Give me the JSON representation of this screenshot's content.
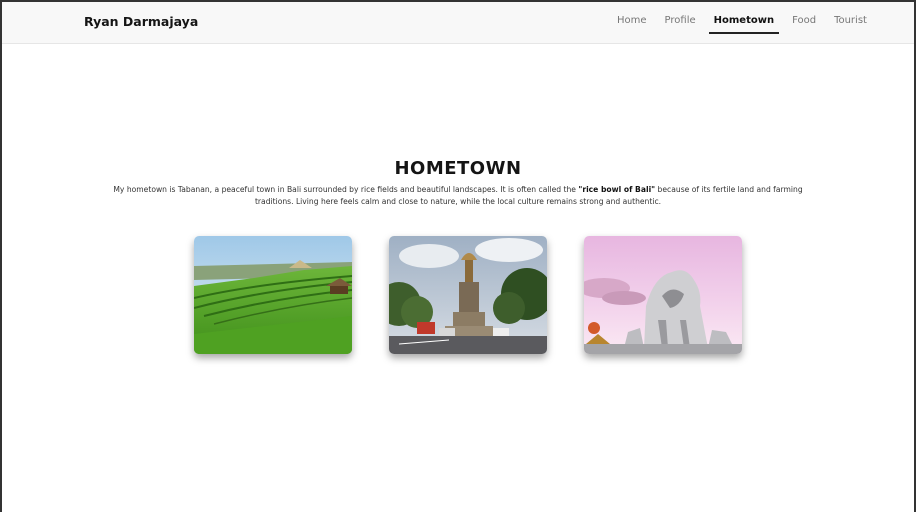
{
  "navbar": {
    "brand": "Ryan Darmajaya",
    "items": [
      {
        "label": "Home",
        "active": false
      },
      {
        "label": "Profile",
        "active": false
      },
      {
        "label": "Hometown",
        "active": true
      },
      {
        "label": "Food",
        "active": false
      },
      {
        "label": "Tourist",
        "active": false
      }
    ]
  },
  "main": {
    "title": "HOMETOWN",
    "description_part1": "My hometown is Tabanan, a peaceful town in Bali surrounded by rice fields and beautiful landscapes. It is often called the ",
    "description_bold": "\"rice bowl of Bali\"",
    "description_part2": " because of its fertile land and farming traditions. Living here feels calm and close to nature, while the local culture remains strong and authentic."
  },
  "colors": {
    "nav_bg": "#f8f8f8",
    "active_underline": "#222222"
  }
}
